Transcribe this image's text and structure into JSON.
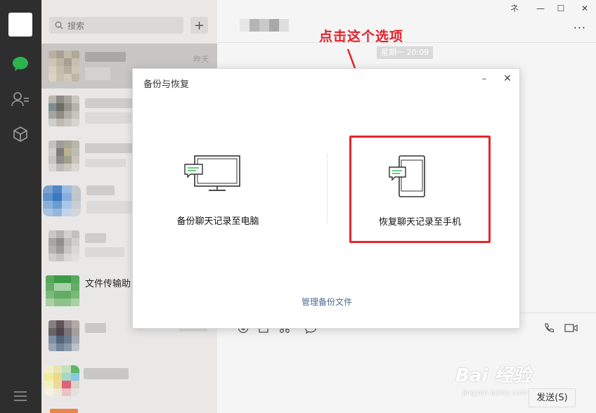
{
  "window": {
    "pin_glyph": "ネ",
    "minimize_glyph": "—",
    "maximize_glyph": "☐",
    "close_glyph": "✕"
  },
  "sidebar_icons": [
    "chat-icon",
    "contacts-icon",
    "favorites-icon",
    "menu-icon"
  ],
  "search": {
    "placeholder": "搜索"
  },
  "chat_list": {
    "items": [
      {
        "time": "昨天"
      },
      {
        "name": "文件传输助"
      }
    ]
  },
  "conversation": {
    "more_glyph": "···",
    "time_chip": "星期一 20:09",
    "send_label": "发送(S)"
  },
  "annotation": {
    "text": "点击这个选项",
    "color": "#e5212b"
  },
  "dialog": {
    "title": "备份与恢复",
    "minimize_glyph": "–",
    "close_glyph": "✕",
    "options": [
      {
        "label": "备份聊天记录至电脑"
      },
      {
        "label": "恢复聊天记录至手机"
      }
    ],
    "manage_link": "管理备份文件"
  },
  "watermark": {
    "brand": "Bai 经验",
    "url": "jingyan.baidu.com"
  },
  "colors": {
    "accent": "#07c160",
    "nav_bg": "#2e2e2e",
    "highlight": "#e4262b",
    "link": "#4f6b94"
  }
}
